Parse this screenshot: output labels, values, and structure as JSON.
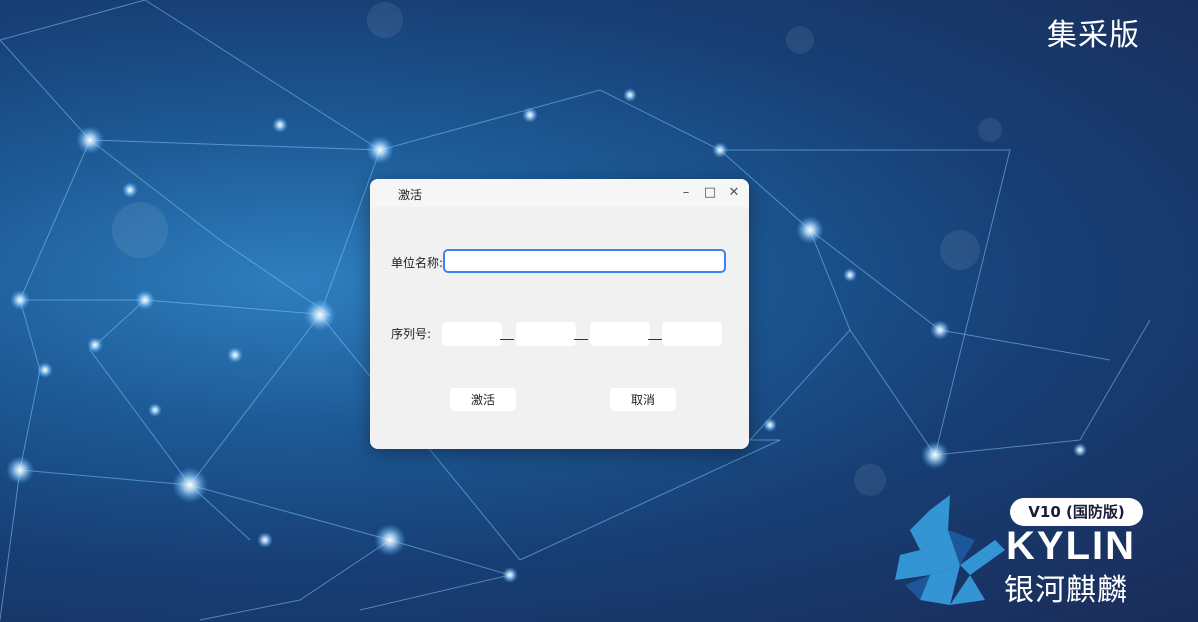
{
  "desktop": {
    "edition_label": "集采版",
    "brand": {
      "version": "V10 (国防版)",
      "name_en": "KYLIN",
      "name_cn": "银河麒麟"
    }
  },
  "dialog": {
    "title": "激活",
    "window_controls": {
      "minimize": "–",
      "maximize": "□",
      "close": "✕"
    },
    "unit_name": {
      "label": "单位名称:",
      "value": ""
    },
    "serial": {
      "label": "序列号:",
      "segments": [
        "",
        "",
        "",
        ""
      ]
    },
    "buttons": {
      "activate": "激活",
      "cancel": "取消"
    }
  },
  "colors": {
    "focus_border": "#3b82f6",
    "dialog_bg": "#f1f1f1"
  }
}
